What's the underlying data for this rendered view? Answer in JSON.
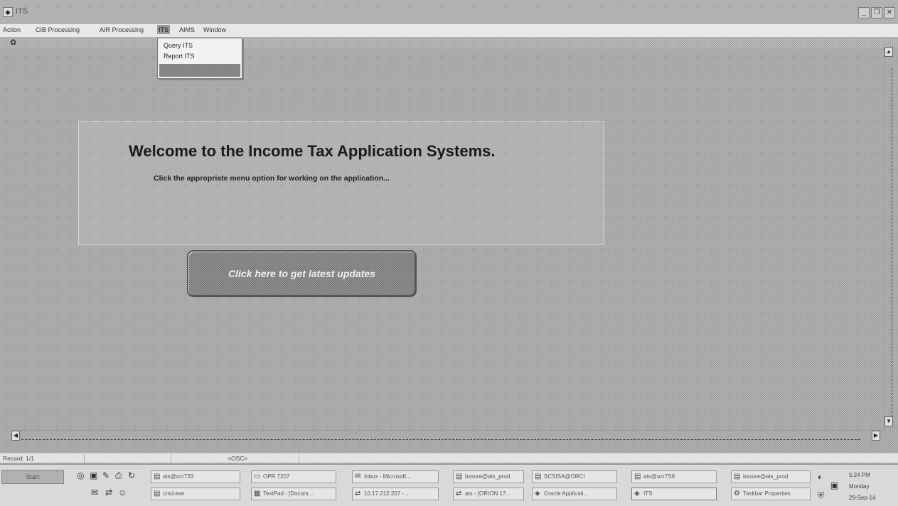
{
  "window": {
    "title": "ITS",
    "minimize_glyph": "_",
    "restore_glyph": "❐",
    "close_glyph": "✕"
  },
  "menu": {
    "items": [
      {
        "label": "Action"
      },
      {
        "label": "CIB Processing"
      },
      {
        "label": "AIR Processing"
      },
      {
        "label": "ITS"
      },
      {
        "label": "AIMS"
      },
      {
        "label": "Window"
      }
    ],
    "open_menu_items": [
      {
        "label": "Query ITS"
      },
      {
        "label": "Report ITS"
      }
    ]
  },
  "main": {
    "welcome_title": "Welcome to the Income Tax Application Systems.",
    "welcome_subtitle": "Click the appropriate menu option for working on the application...",
    "updates_button_label": "Click here to get latest updates"
  },
  "status": {
    "record": "Record: 1/1",
    "mode": "<OSC>"
  },
  "taskbar": {
    "start_label": "Start",
    "buttons_row1": [
      {
        "label": "ats@ocr733",
        "icon": "terminal-icon"
      },
      {
        "label": "OPR 7207",
        "icon": "folder-icon"
      },
      {
        "label": "Inbox - Microsoft...",
        "icon": "mail-icon"
      },
      {
        "label": "bssore@ats_prod",
        "icon": "terminal-icon"
      },
      {
        "label": "SCSISA@ORCI",
        "icon": "terminal-icon"
      },
      {
        "label": "ats@ocr7S6",
        "icon": "terminal-icon"
      },
      {
        "label": "bssore@ats_prod",
        "icon": "terminal-icon"
      }
    ],
    "buttons_row2": [
      {
        "label": "cmd.exe",
        "icon": "terminal-icon"
      },
      {
        "label": "TextPad - [Docum...",
        "icon": "document-icon"
      },
      {
        "label": "10.17.212.207 -...",
        "icon": "network-icon"
      },
      {
        "label": "ats - [ORION 17...",
        "icon": "network-icon"
      },
      {
        "label": "Oracle Applicati...",
        "icon": "app-icon"
      },
      {
        "label": "ITS",
        "icon": "app-icon"
      },
      {
        "label": "Taskbar Properties",
        "icon": "gear-icon"
      }
    ],
    "clock": {
      "time": "5:24 PM",
      "day": "Monday",
      "date": "29-Sep-14"
    }
  },
  "colors": {
    "background": "#bdbdbd",
    "menu_bar": "#e8e8e8",
    "button_border": "#555555"
  }
}
